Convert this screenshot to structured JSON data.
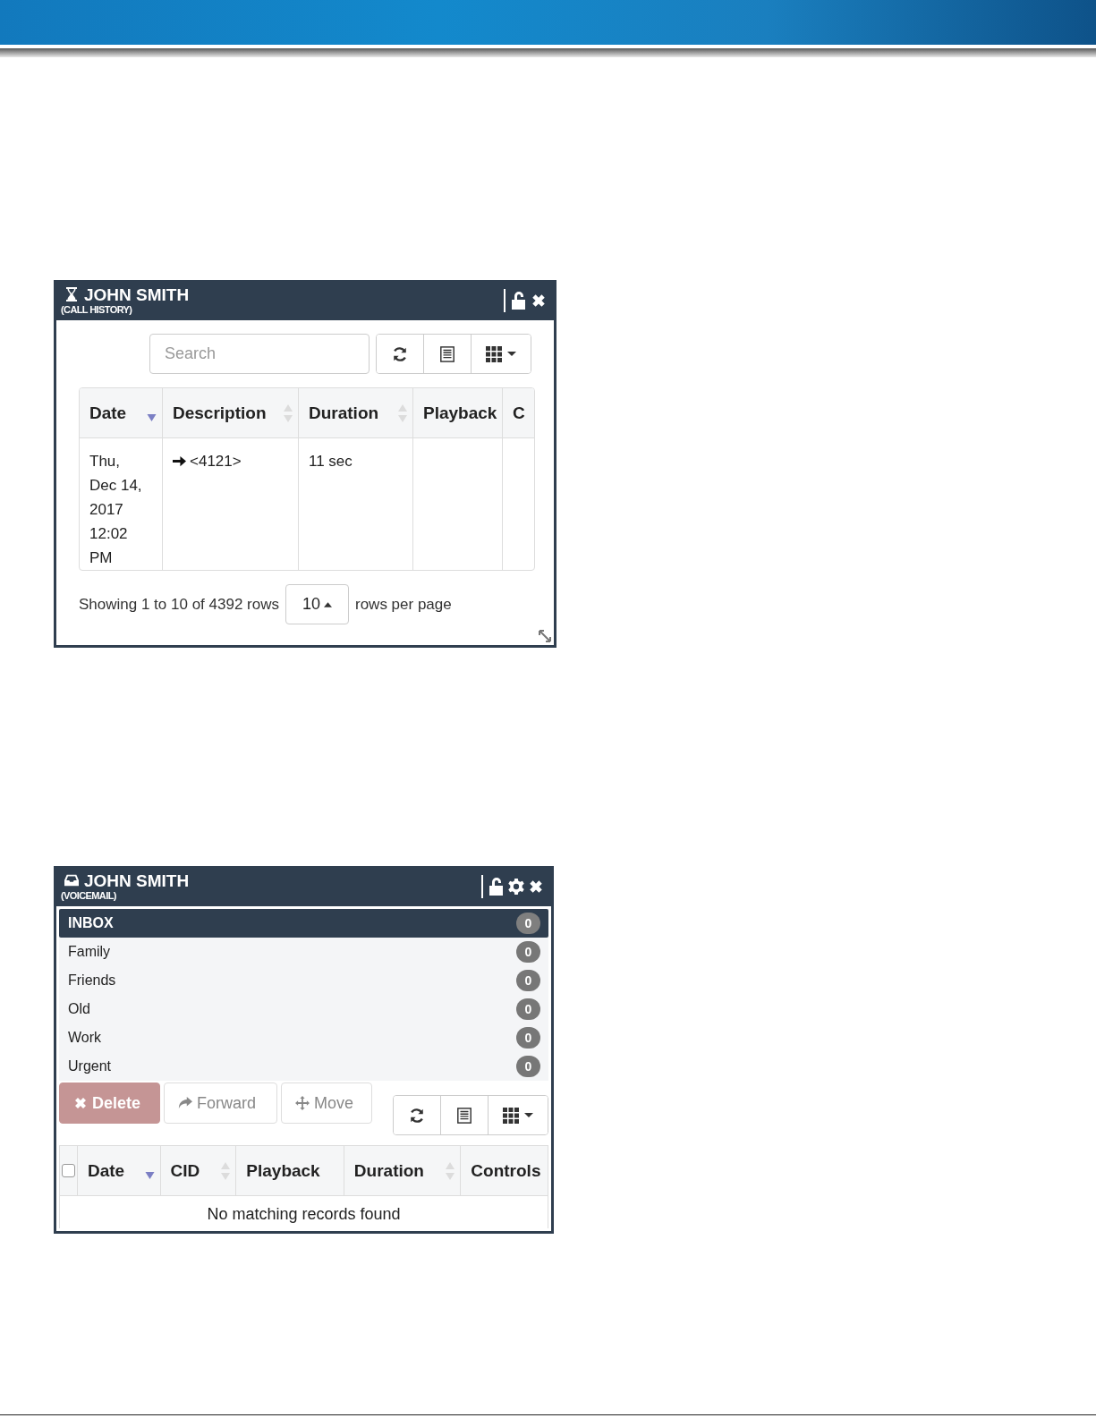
{
  "call_history": {
    "title": "JOHN SMITH",
    "subtitle": "(CALL HISTORY)",
    "header_controls": [
      {
        "kind": "lock"
      },
      {
        "kind": "close"
      }
    ],
    "search": {
      "placeholder": "Search"
    },
    "toolbar": [
      {
        "kind": "refresh"
      },
      {
        "kind": "list"
      },
      {
        "kind": "columns"
      }
    ],
    "table": {
      "columns": [
        {
          "label": "Date",
          "sorted_descending": true,
          "sortable": true
        },
        {
          "label": "Description",
          "sorted_descending": false,
          "sortable": true
        },
        {
          "label": "Duration",
          "sorted_descending": false,
          "sortable": true
        },
        {
          "label": "Playback"
        },
        {
          "label": "C"
        }
      ],
      "rows": [
        {
          "date": "Thu, Dec 14, 2017 12:02 PM",
          "kind": "outgoing",
          "description": "<4121>",
          "duration": "11 sec"
        }
      ]
    },
    "footer": {
      "showing": "Showing 1 to 10 of 4392 rows",
      "page_size": "10",
      "suffix": "rows per page"
    }
  },
  "voicemail": {
    "title": "JOHN SMITH",
    "subtitle": "(VOICEMAIL)",
    "header_controls": [
      {
        "kind": "lock"
      },
      {
        "kind": "gear"
      },
      {
        "kind": "close"
      }
    ],
    "folders": [
      {
        "name": "INBOX",
        "count": "0",
        "selected": true
      },
      {
        "name": "Family",
        "count": "0",
        "selected": false
      },
      {
        "name": "Friends",
        "count": "0",
        "selected": false
      },
      {
        "name": "Old",
        "count": "0",
        "selected": false
      },
      {
        "name": "Work",
        "count": "0",
        "selected": false
      },
      {
        "name": "Urgent",
        "count": "0",
        "selected": false
      }
    ],
    "actions": [
      {
        "label": "Delete",
        "kind": "delete"
      },
      {
        "label": "Forward",
        "kind": "forward"
      },
      {
        "label": "Move",
        "kind": "move"
      }
    ],
    "toolbar": [
      {
        "kind": "refresh"
      },
      {
        "kind": "list"
      },
      {
        "kind": "columns"
      }
    ],
    "table": {
      "select_all": {
        "checked": false
      },
      "columns": [
        {
          "label": "Date",
          "sorted_descending": true,
          "sortable": true
        },
        {
          "label": "CID",
          "sorted_descending": false,
          "sortable": true
        },
        {
          "label": "Playback"
        },
        {
          "label": "Duration",
          "sorted_descending": false,
          "sortable": true
        },
        {
          "label": "Controls"
        }
      ],
      "empty_message": "No matching records found"
    }
  }
}
